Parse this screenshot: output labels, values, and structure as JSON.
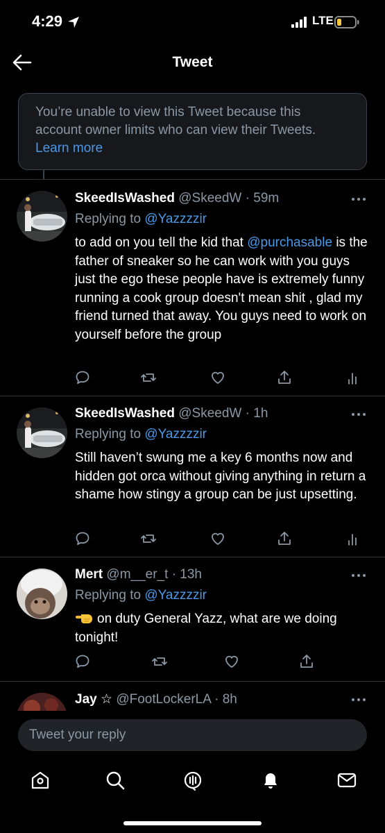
{
  "status_bar": {
    "time": "4:29",
    "network": "LTE"
  },
  "header": {
    "title": "Tweet"
  },
  "notice": {
    "text": "You’re unable to view this Tweet because this account owner limits who can view their Tweets.",
    "link": "Learn more"
  },
  "tweets": [
    {
      "name": "SkeedIsWashed",
      "handle": "@SkeedW",
      "separator": "·",
      "time": "59m",
      "replying_label": "Replying to",
      "replying_to": "@Yazzzzir",
      "body_pre": "to add on you tell the kid that ",
      "body_mention": "@purchasable",
      "body_post": " is the father of sneaker so he can work with you guys just the ego these people have is extremely funny running a cook group doesn't mean shit , glad my friend turned that away. You guys need to work on yourself before the group"
    },
    {
      "name": "SkeedIsWashed",
      "handle": "@SkeedW",
      "separator": "·",
      "time": "1h",
      "replying_label": "Replying to",
      "replying_to": "@Yazzzzir",
      "body": "Still haven’t swung me a key 6 months now and hidden got orca without giving anything in return a shame how stingy a group can be just upsetting."
    },
    {
      "name": "Mert",
      "handle": "@m__er_t",
      "separator": "·",
      "time": "13h",
      "replying_label": "Replying to",
      "replying_to": "@Yazzzzir",
      "emoji": "backhand-index-pointing-left",
      "body": "on duty General Yazz, what are we doing tonight!"
    },
    {
      "name": "Jay",
      "badge": "☆",
      "handle": "@FootLockerLA",
      "separator": "·",
      "time": "8h"
    }
  ],
  "reply_box": {
    "placeholder": "Tweet your reply"
  },
  "tabs": [
    "home-icon",
    "search-icon",
    "spaces-icon",
    "notifications-icon",
    "messages-icon"
  ],
  "colors": {
    "background": "#000000",
    "link": "#4a99e9",
    "muted": "#8b98a5",
    "divider": "#2f3336",
    "battery": "#f6c544"
  }
}
